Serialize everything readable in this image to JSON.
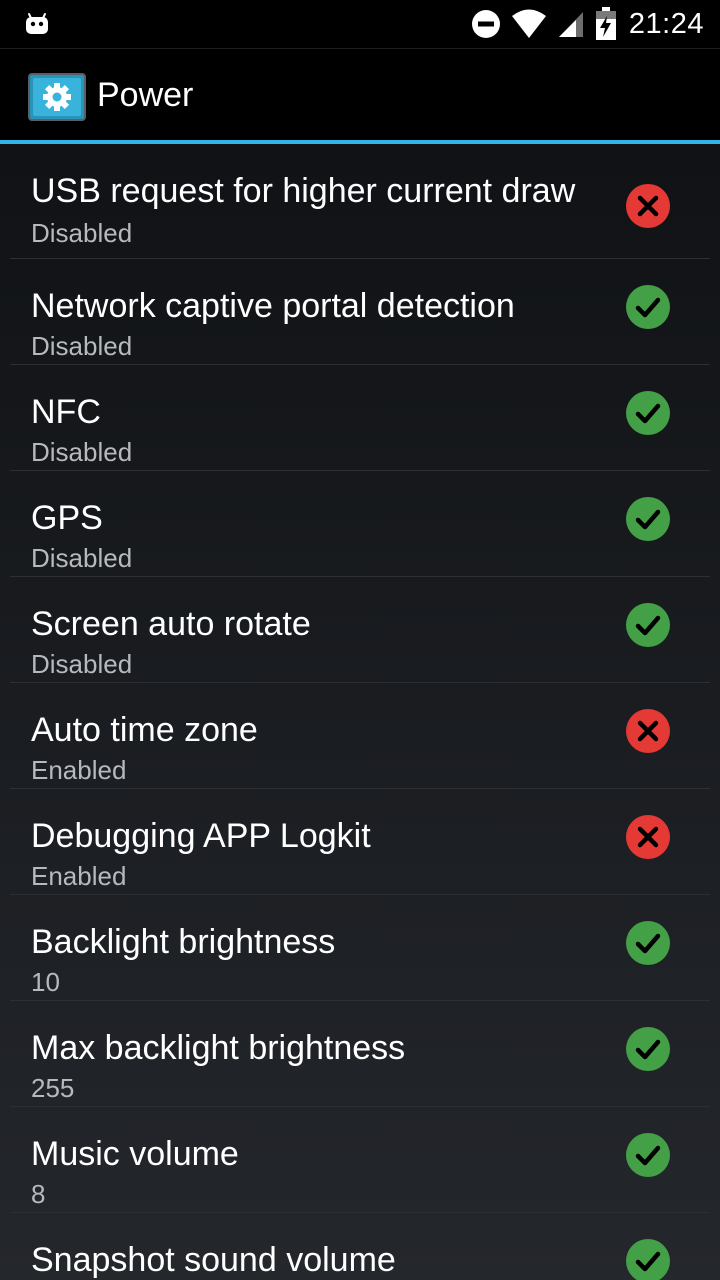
{
  "status_bar": {
    "time": "21:24",
    "icons": [
      "android-debug-icon",
      "do-not-disturb-icon",
      "wifi-icon",
      "cell-signal-icon",
      "battery-charging-icon"
    ]
  },
  "action_bar": {
    "title": "Power",
    "icon": "settings-gear-icon"
  },
  "colors": {
    "accent": "#33b5e5",
    "ok": "#43a047",
    "bad": "#e53935"
  },
  "items": [
    {
      "title": "USB request for higher current draw",
      "summary": "Disabled",
      "status": "bad"
    },
    {
      "title": "Network captive portal detection",
      "summary": "Disabled",
      "status": "ok"
    },
    {
      "title": "NFC",
      "summary": "Disabled",
      "status": "ok"
    },
    {
      "title": "GPS",
      "summary": "Disabled",
      "status": "ok"
    },
    {
      "title": "Screen auto rotate",
      "summary": "Disabled",
      "status": "ok"
    },
    {
      "title": "Auto time zone",
      "summary": "Enabled",
      "status": "bad"
    },
    {
      "title": "Debugging APP Logkit",
      "summary": "Enabled",
      "status": "bad"
    },
    {
      "title": "Backlight brightness",
      "summary": "10",
      "status": "ok"
    },
    {
      "title": "Max backlight brightness",
      "summary": "255",
      "status": "ok"
    },
    {
      "title": "Music volume",
      "summary": "8",
      "status": "ok"
    },
    {
      "title": "Snapshot sound volume",
      "summary": "",
      "status": "ok"
    }
  ]
}
